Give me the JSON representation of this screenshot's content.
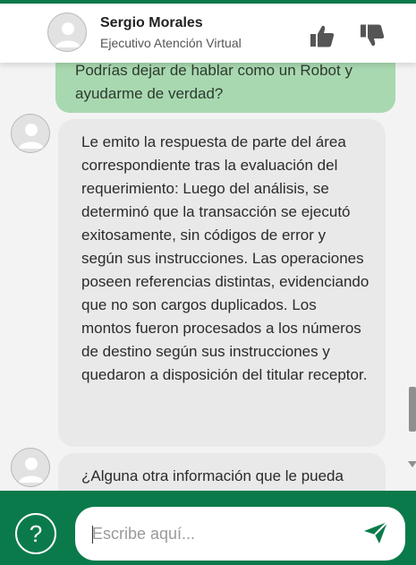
{
  "header": {
    "agent_name": "Sergio Morales",
    "agent_role": "Ejecutivo Atención Virtual"
  },
  "messages": {
    "user_partial": "Podrías dejar de hablar como un Robot y ayudarme de verdad?",
    "bot_reply": "Le emito la respuesta de parte del área correspondiente tras la evaluación del requerimiento:  Luego del análisis, se determinó que la transacción se ejecutó exitosamente, sin códigos de error y según sus instrucciones. Las operaciones poseen referencias distintas, evidenciando que no son cargos duplicados. Los montos fueron procesados a los números de destino según sus instrucciones y quedaron a disposición del titular receptor.",
    "bot_partial": "¿Alguna otra información que le pueda"
  },
  "footer": {
    "help_label": "?",
    "input_placeholder": "Escribe aquí..."
  },
  "colors": {
    "brand_green": "#0b7a4b",
    "user_bubble": "#a8d8b0",
    "bot_bubble": "#e9e9e9"
  },
  "icons": [
    "avatar-icon",
    "thumbs-up-icon",
    "thumbs-down-icon",
    "help-icon",
    "send-icon"
  ]
}
